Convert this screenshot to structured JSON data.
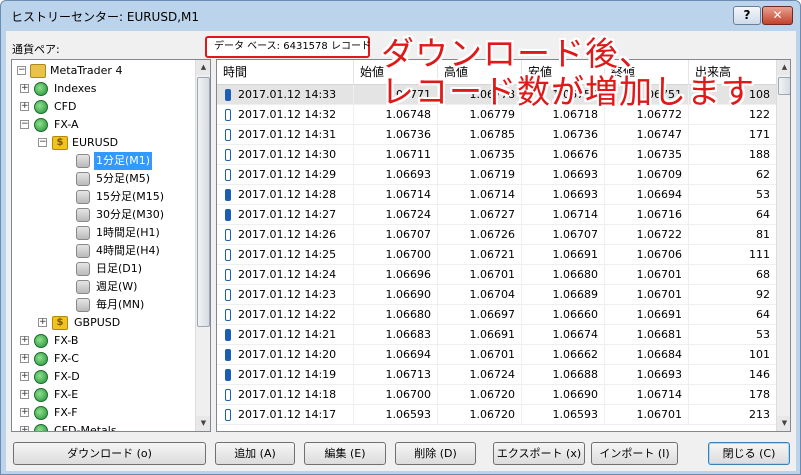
{
  "window": {
    "title": "ヒストリーセンター: EURUSD,M1",
    "help_label": "?",
    "close_label": "✕"
  },
  "pair_label": "通貨ペア:",
  "record_count": "データ ベース: 6431578 レコード",
  "annotation": {
    "line1": "ダウンロード後、",
    "line2": "レコード数が増加します"
  },
  "tree": {
    "root": "MetaTrader 4",
    "groups": [
      "Indexes",
      "CFD",
      "FX-A"
    ],
    "symbol": "EURUSD",
    "timeframes": [
      "1分足(M1)",
      "5分足(M5)",
      "15分足(M15)",
      "30分足(M30)",
      "1時間足(H1)",
      "4時間足(H4)",
      "日足(D1)",
      "週足(W)",
      "毎月(MN)"
    ],
    "symbol2": "GBPUSD",
    "more_groups": [
      "FX-B",
      "FX-C",
      "FX-D",
      "FX-E",
      "FX-F",
      "CFD-Metals"
    ]
  },
  "grid": {
    "columns": [
      "時間",
      "始値",
      "高値",
      "安値",
      "終値",
      "出来高"
    ],
    "rows": [
      {
        "time": "2017.01.12 14:33",
        "open": "1.06771",
        "high": "1.06778",
        "low": "1.06750",
        "close": "1.06751",
        "volume": "108",
        "bull": true
      },
      {
        "time": "2017.01.12 14:32",
        "open": "1.06748",
        "high": "1.06779",
        "low": "1.06718",
        "close": "1.06772",
        "volume": "122",
        "bull": false
      },
      {
        "time": "2017.01.12 14:31",
        "open": "1.06736",
        "high": "1.06785",
        "low": "1.06736",
        "close": "1.06747",
        "volume": "171",
        "bull": false
      },
      {
        "time": "2017.01.12 14:30",
        "open": "1.06711",
        "high": "1.06735",
        "low": "1.06676",
        "close": "1.06735",
        "volume": "188",
        "bull": false
      },
      {
        "time": "2017.01.12 14:29",
        "open": "1.06693",
        "high": "1.06719",
        "low": "1.06693",
        "close": "1.06709",
        "volume": "62",
        "bull": false
      },
      {
        "time": "2017.01.12 14:28",
        "open": "1.06714",
        "high": "1.06714",
        "low": "1.06693",
        "close": "1.06694",
        "volume": "53",
        "bull": true
      },
      {
        "time": "2017.01.12 14:27",
        "open": "1.06724",
        "high": "1.06727",
        "low": "1.06714",
        "close": "1.06716",
        "volume": "64",
        "bull": true
      },
      {
        "time": "2017.01.12 14:26",
        "open": "1.06707",
        "high": "1.06726",
        "low": "1.06707",
        "close": "1.06722",
        "volume": "81",
        "bull": false
      },
      {
        "time": "2017.01.12 14:25",
        "open": "1.06700",
        "high": "1.06721",
        "low": "1.06691",
        "close": "1.06706",
        "volume": "111",
        "bull": false
      },
      {
        "time": "2017.01.12 14:24",
        "open": "1.06696",
        "high": "1.06701",
        "low": "1.06680",
        "close": "1.06701",
        "volume": "68",
        "bull": false
      },
      {
        "time": "2017.01.12 14:23",
        "open": "1.06690",
        "high": "1.06704",
        "low": "1.06689",
        "close": "1.06701",
        "volume": "92",
        "bull": false
      },
      {
        "time": "2017.01.12 14:22",
        "open": "1.06680",
        "high": "1.06697",
        "low": "1.06660",
        "close": "1.06691",
        "volume": "64",
        "bull": false
      },
      {
        "time": "2017.01.12 14:21",
        "open": "1.06683",
        "high": "1.06691",
        "low": "1.06674",
        "close": "1.06681",
        "volume": "53",
        "bull": true
      },
      {
        "time": "2017.01.12 14:20",
        "open": "1.06694",
        "high": "1.06701",
        "low": "1.06662",
        "close": "1.06684",
        "volume": "101",
        "bull": true
      },
      {
        "time": "2017.01.12 14:19",
        "open": "1.06713",
        "high": "1.06724",
        "low": "1.06688",
        "close": "1.06693",
        "volume": "146",
        "bull": true
      },
      {
        "time": "2017.01.12 14:18",
        "open": "1.06700",
        "high": "1.06720",
        "low": "1.06690",
        "close": "1.06714",
        "volume": "178",
        "bull": false
      },
      {
        "time": "2017.01.12 14:17",
        "open": "1.06593",
        "high": "1.06720",
        "low": "1.06593",
        "close": "1.06701",
        "volume": "213",
        "bull": false
      }
    ]
  },
  "buttons": {
    "download": "ダウンロード (o)",
    "add": "追加 (A)",
    "edit": "編集 (E)",
    "delete": "削除 (D)",
    "export": "エクスポート (x)",
    "import": "インポート (I)",
    "close": "閉じる (C)"
  },
  "colors": {
    "annotation": "#e01818",
    "selection": "#3399ff",
    "candle": "#1a5fb4"
  }
}
